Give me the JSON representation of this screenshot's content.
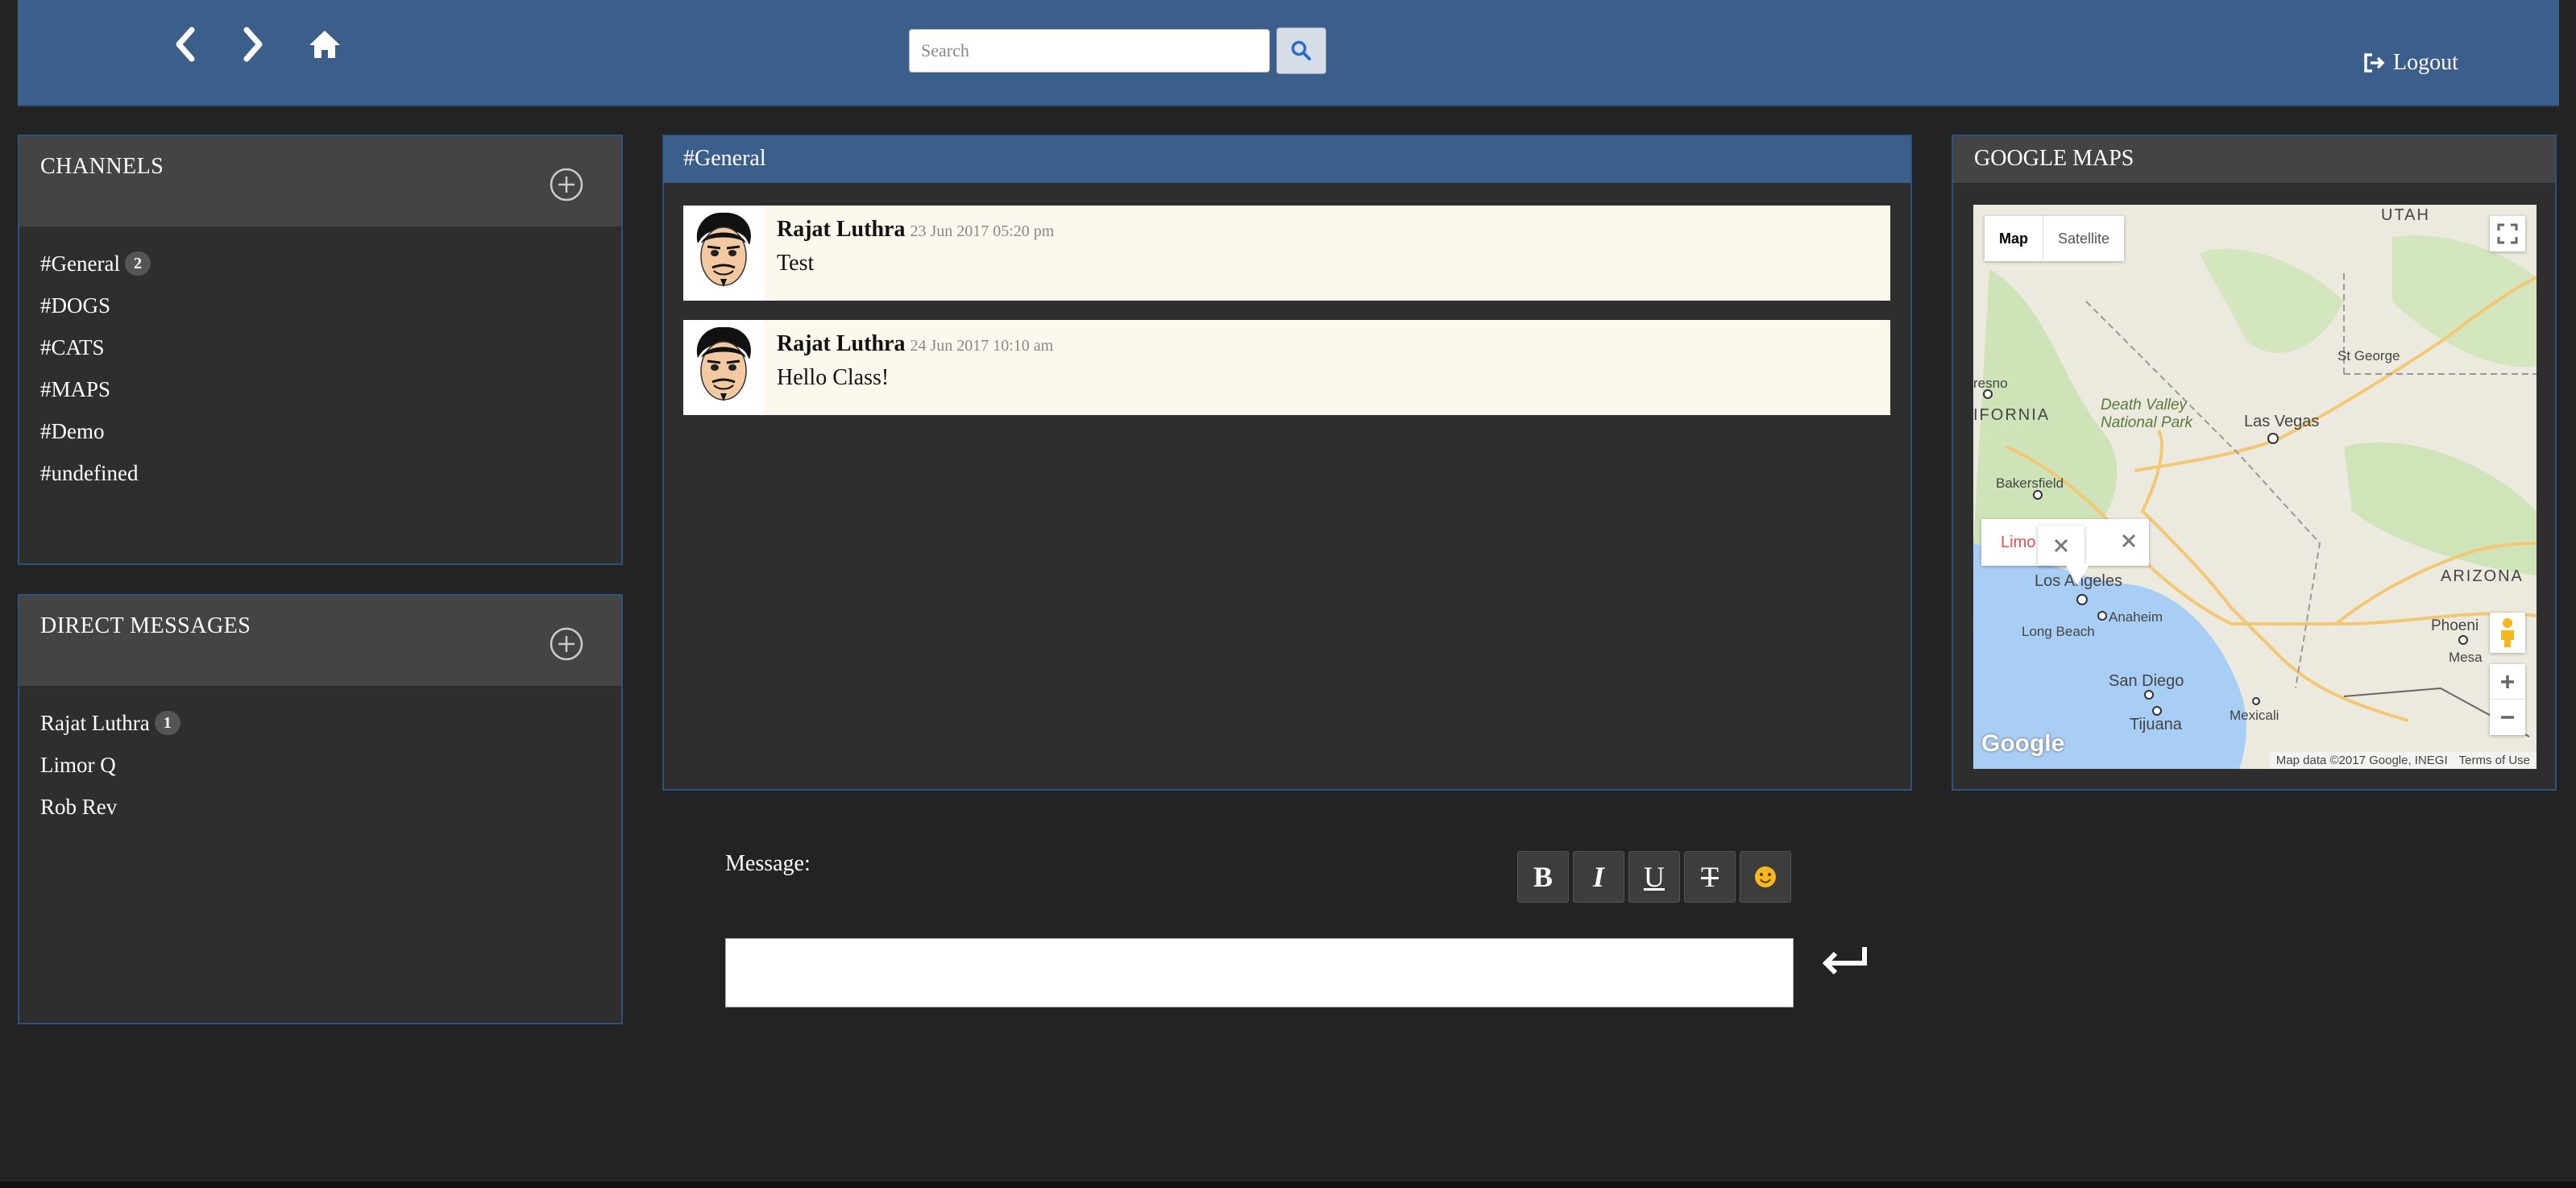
{
  "search": {
    "placeholder": "Search"
  },
  "header": {
    "logout_label": "Logout"
  },
  "channels": {
    "title": "CHANNELS",
    "items": [
      {
        "label": "#General",
        "badge": "2"
      },
      {
        "label": "#DOGS"
      },
      {
        "label": "#CATS"
      },
      {
        "label": "#MAPS"
      },
      {
        "label": "#Demo"
      },
      {
        "label": "#undefined"
      }
    ]
  },
  "direct_messages": {
    "title": "DIRECT MESSAGES",
    "items": [
      {
        "label": "Rajat Luthra",
        "badge": "1"
      },
      {
        "label": "Limor Q"
      },
      {
        "label": "Rob Rev"
      }
    ]
  },
  "chat": {
    "channel_title": "#General",
    "messages": [
      {
        "author": "Rajat Luthra",
        "time": "23 Jun 2017 05:20 pm",
        "text": "Test"
      },
      {
        "author": "Rajat Luthra",
        "time": "24 Jun 2017 10:10 am",
        "text": "Hello Class!"
      }
    ]
  },
  "composer": {
    "label": "Message:",
    "buttons": [
      "B",
      "I",
      "U",
      "T"
    ],
    "input_value": ""
  },
  "map": {
    "title": "GOOGLE MAPS",
    "type_map": "Map",
    "type_satellite": "Satellite",
    "info_text": "Limo",
    "labels": {
      "utah": "UTAH",
      "st_george": "St George",
      "fresno": "resno",
      "california": "IFORNIA",
      "death_valley": "Death Valley\nNational Park",
      "las_vegas": "Las Vegas",
      "bakersfield": "Bakersfield",
      "los_angeles": "Los Angeles",
      "anaheim": "Anaheim",
      "long_beach": "Long Beach",
      "san_diego": "San Diego",
      "tijuana": "Tijuana",
      "mexicali": "Mexicali",
      "arizona": "ARIZONA",
      "phoenix": "Phoeni",
      "mesa": "Mesa"
    },
    "attribution": "Map data ©2017 Google, INEGI",
    "terms": "Terms of Use",
    "logo": "Google"
  },
  "colors": {
    "header_bg": "#3b5f8a",
    "panel_bg": "#2e2e2e",
    "panel_head": "#444444",
    "message_bg": "#fdf8ee"
  }
}
